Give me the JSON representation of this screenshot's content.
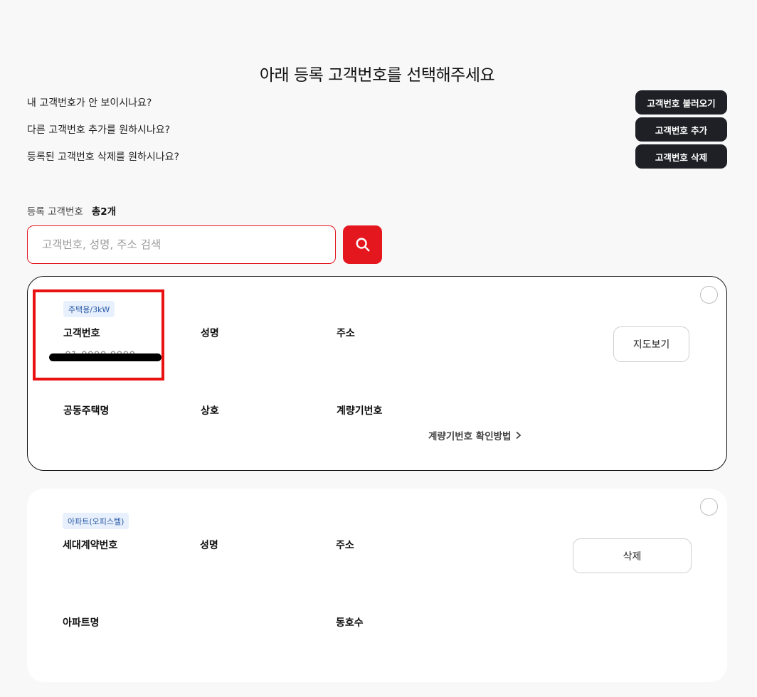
{
  "header": {
    "title": "아래 등록 고객번호를 선택해주세요"
  },
  "questions": [
    {
      "text": "내 고객번호가 안 보이시나요?",
      "button": "고객번호 불러오기"
    },
    {
      "text": "다른 고객번호 추가를 원하시나요?",
      "button": "고객번호 추가"
    },
    {
      "text": "등록된 고객번호 삭제를 원하시나요?",
      "button": "고객번호 삭제"
    }
  ],
  "registered": {
    "label": "등록 고객번호",
    "count": "총2개"
  },
  "search": {
    "placeholder": "고객번호, 성명, 주소 검색",
    "icon": "search-icon"
  },
  "cards": [
    {
      "badge": "주택용/3kW",
      "fields": [
        "고객번호",
        "성명",
        "주소"
      ],
      "value_redacted": "01-0000-0000",
      "fields2": [
        "공동주택명",
        "상호",
        "계량기번호"
      ],
      "button": "지도보기",
      "link": "계량기번호 확인방법",
      "link_icon": "chevron-right-icon"
    },
    {
      "badge": "아파트(오피스텔)",
      "fields": [
        "세대계약번호",
        "성명",
        "주소"
      ],
      "fields2": [
        "아파트명",
        "동호수"
      ],
      "button": "삭제"
    }
  ],
  "colors": {
    "accent": "#e4171f",
    "dark_button": "#1f2026",
    "badge_bg": "#e7f0fc",
    "badge_text": "#2a5aa8",
    "highlight": "#ea1111"
  }
}
